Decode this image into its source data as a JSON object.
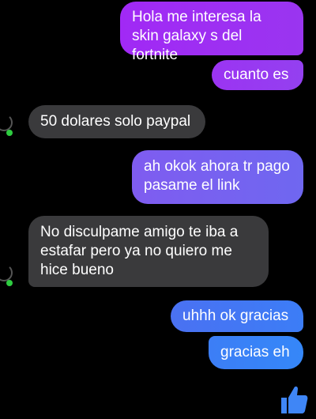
{
  "messages": [
    {
      "direction": "sent",
      "text": "Hola me interesa la skin galaxy s del fortnite"
    },
    {
      "direction": "sent",
      "text": "cuanto es"
    },
    {
      "direction": "received",
      "text": "50 dolares solo paypal"
    },
    {
      "direction": "sent",
      "text": "ah okok ahora tr pago pasame el link"
    },
    {
      "direction": "received",
      "text": "No disculpame amigo te iba a estafar pero ya no quiero me hice bueno"
    },
    {
      "direction": "sent",
      "text": "uhhh ok gracias"
    },
    {
      "direction": "sent",
      "text": "gracias eh"
    }
  ],
  "colors": {
    "background": "#000000",
    "received_bubble": "#3a3a3c",
    "sent_gradient_top": "#a129f5",
    "sent_gradient_bottom": "#3587f8",
    "active_dot": "#2ecc40",
    "like_button": "#3f86f6"
  },
  "icons": {
    "like": "thumbs-up-icon",
    "presence": "active-status-dot"
  }
}
